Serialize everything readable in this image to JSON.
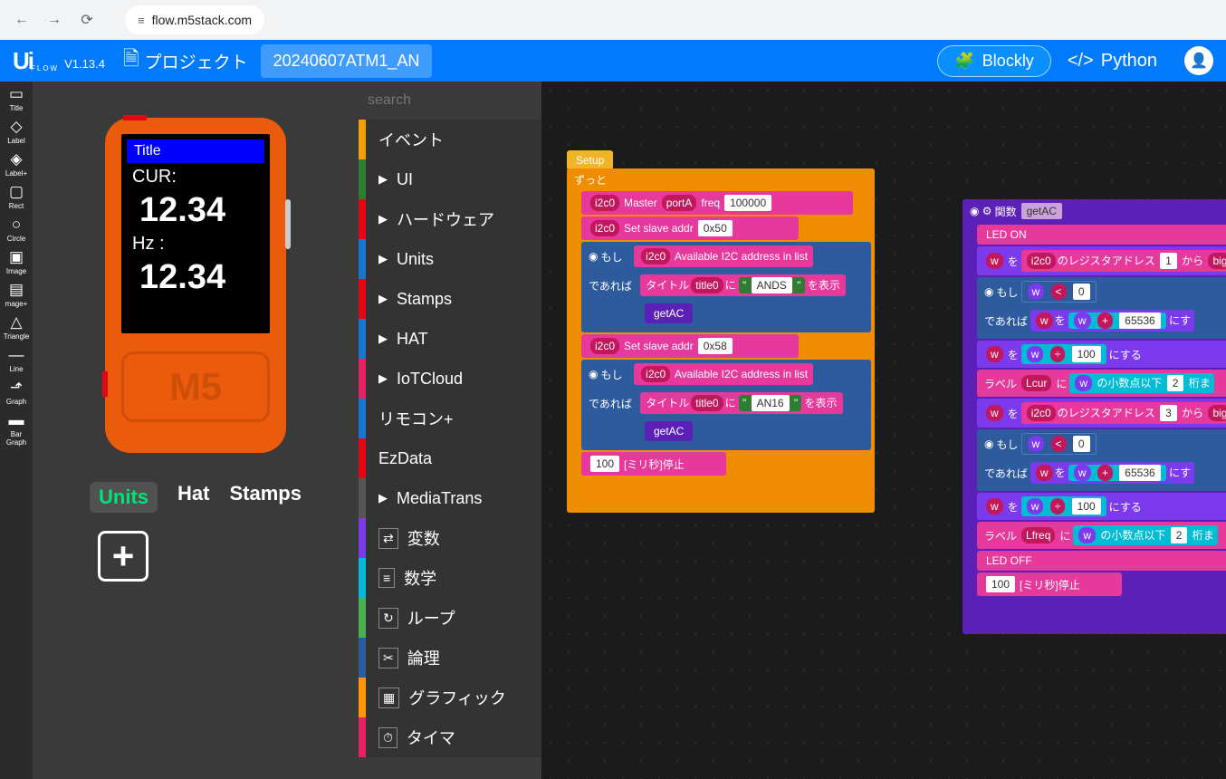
{
  "browser": {
    "url": "flow.m5stack.com"
  },
  "header": {
    "logo": "Ui",
    "flow": "FLOW",
    "version": "V1.13.4",
    "project_label": "プロジェクト",
    "project_name": "20240607ATM1_AN",
    "blockly": "Blockly",
    "python": "Python"
  },
  "tools": [
    {
      "icon": "▭",
      "label": "Title"
    },
    {
      "icon": "◇",
      "label": "Label"
    },
    {
      "icon": "◈",
      "label": "Label+"
    },
    {
      "icon": "▢",
      "label": "Rect"
    },
    {
      "icon": "○",
      "label": "Circle"
    },
    {
      "icon": "▣",
      "label": "Image"
    },
    {
      "icon": "▤",
      "label": "mage+"
    },
    {
      "icon": "△",
      "label": "Triangle"
    },
    {
      "icon": "—",
      "label": "Line"
    },
    {
      "icon": "⬏",
      "label": "Graph"
    },
    {
      "icon": "▬",
      "label": "Bar Graph"
    }
  ],
  "screen": {
    "title": "Title",
    "cur_label": "CUR:",
    "cur_val": "12.34",
    "hz_label": "Hz :",
    "hz_val": "12.34",
    "m5": "M5"
  },
  "tabs": {
    "units": "Units",
    "hat": "Hat",
    "stamps": "Stamps"
  },
  "search": {
    "placeholder": "search"
  },
  "categories": [
    {
      "c": "#f0a000",
      "label": "イベント",
      "arrow": ""
    },
    {
      "c": "#2e7d32",
      "label": "UI",
      "arrow": "▶"
    },
    {
      "c": "#e30613",
      "label": "ハードウェア",
      "arrow": "▶"
    },
    {
      "c": "#1976d2",
      "label": "Units",
      "arrow": "▶"
    },
    {
      "c": "#e30613",
      "label": "Stamps",
      "arrow": "▶"
    },
    {
      "c": "#1976d2",
      "label": "HAT",
      "arrow": "▶"
    },
    {
      "c": "#e91e63",
      "label": "IoTCloud",
      "arrow": "▶"
    },
    {
      "c": "#1976d2",
      "label": "リモコン+",
      "arrow": ""
    },
    {
      "c": "#e30613",
      "label": "EzData",
      "arrow": ""
    },
    {
      "c": "#555",
      "label": "MediaTrans",
      "arrow": "▶"
    },
    {
      "c": "#7c3aed",
      "label": "変数",
      "icon": "⇄"
    },
    {
      "c": "#00bcd4",
      "label": "数学",
      "icon": "≡"
    },
    {
      "c": "#4caf50",
      "label": "ループ",
      "icon": "↻"
    },
    {
      "c": "#2d5b9e",
      "label": "論理",
      "icon": "✂"
    },
    {
      "c": "#ff9800",
      "label": "グラフィック",
      "icon": "▦"
    },
    {
      "c": "#e91e63",
      "label": "タイマ",
      "icon": "⏱"
    }
  ],
  "blocks": {
    "setup": "Setup",
    "zutto": "ずっと",
    "i2c0": "i2c0",
    "master": "Master",
    "portA": "portA",
    "freq": "freq",
    "freq_val": "100000",
    "slave": "Set slave addr",
    "addr1": "0x50",
    "addr2": "0x58",
    "if1": "もし",
    "avail": "Available I2C address in list",
    "deareba": "であれば",
    "title": "タイトル",
    "title0": "title0",
    "ni": "に",
    "ands": "ANDS",
    "an16": "AN16",
    "wohyo": "を表示",
    "getAC": "getAC",
    "ms": "100",
    "mslabel": "[ミリ秒]停止",
    "kansuu": "関数",
    "ledon": "LED ON",
    "ledoff": "LED OFF",
    "w": "w",
    "wo": "を",
    "reg": "のレジスタアドレス",
    "r1": "1",
    "r3": "3",
    "kara": "から",
    "big": "big",
    "lt": "<",
    "zero": "0",
    "plus": "+",
    "div": "÷",
    "h65536": "65536",
    "h100": "100",
    "nisuru": "にする",
    "nisu": "にす",
    "lbl": "ラベル",
    "lcur": "Lcur",
    "lfreq": "Lfreq",
    "shosuu": "の小数点以下",
    "d2": "2",
    "keta": "桁ま"
  }
}
